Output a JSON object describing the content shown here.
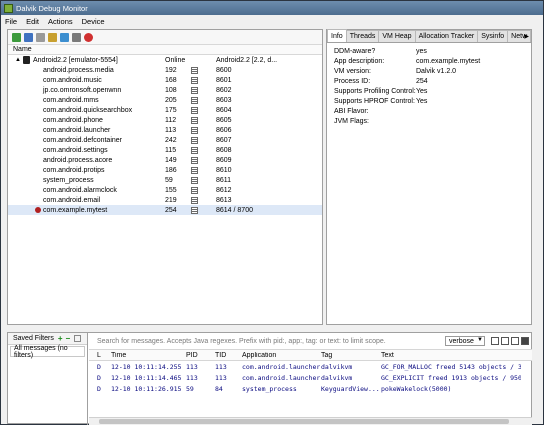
{
  "window": {
    "title": "Dalvik Debug Monitor"
  },
  "menu": [
    "File",
    "Edit",
    "Actions",
    "Device"
  ],
  "devices": {
    "columns": {
      "name": "Name"
    },
    "device": {
      "name": "Android2.2 [emulator-5554]",
      "status": "Online",
      "target": "Android2.2 [2.2, d..."
    },
    "processes": [
      {
        "name": "android.process.media",
        "pid": "192",
        "port": "8600"
      },
      {
        "name": "com.android.music",
        "pid": "168",
        "port": "8601"
      },
      {
        "name": "jp.co.omronsoft.openwnn",
        "pid": "108",
        "port": "8602"
      },
      {
        "name": "com.android.mms",
        "pid": "205",
        "port": "8603"
      },
      {
        "name": "com.android.quicksearchbox",
        "pid": "175",
        "port": "8604"
      },
      {
        "name": "com.android.phone",
        "pid": "112",
        "port": "8605"
      },
      {
        "name": "com.android.launcher",
        "pid": "113",
        "port": "8606"
      },
      {
        "name": "com.android.defcontainer",
        "pid": "242",
        "port": "8607"
      },
      {
        "name": "com.android.settings",
        "pid": "115",
        "port": "8608"
      },
      {
        "name": "android.process.acore",
        "pid": "149",
        "port": "8609"
      },
      {
        "name": "com.android.protips",
        "pid": "186",
        "port": "8610"
      },
      {
        "name": "system_process",
        "pid": "59",
        "port": "8611"
      },
      {
        "name": "com.android.alarmclock",
        "pid": "155",
        "port": "8612"
      },
      {
        "name": "com.android.email",
        "pid": "219",
        "port": "8613"
      },
      {
        "name": "com.example.mytest",
        "pid": "254",
        "port": "8614 / 8700"
      }
    ]
  },
  "tabs": [
    "Info",
    "Threads",
    "VM Heap",
    "Allocation Tracker",
    "Sysinfo",
    "Netw"
  ],
  "info": [
    {
      "k": "DDM-aware?",
      "v": "yes"
    },
    {
      "k": "App description:",
      "v": "com.example.mytest"
    },
    {
      "k": "VM version:",
      "v": "Dalvik v1.2.0"
    },
    {
      "k": "Process ID:",
      "v": "254"
    },
    {
      "k": "Supports Profiling Control:",
      "v": "Yes"
    },
    {
      "k": "Supports HPROF Control:",
      "v": "Yes"
    },
    {
      "k": "ABI Flavor:",
      "v": ""
    },
    {
      "k": "JVM Flags:",
      "v": ""
    }
  ],
  "filters": {
    "title": "Saved Filters",
    "items": [
      "All messages (no filters)"
    ]
  },
  "logcat": {
    "search_placeholder": "Search for messages. Accepts Java regexes. Prefix with pid:, app:, tag: or text: to limit scope.",
    "level": "verbose",
    "headers": [
      "L",
      "Time",
      "PID",
      "TID",
      "Application",
      "Tag",
      "Text"
    ],
    "rows": [
      [
        "D",
        "12-10 10:11:14.255",
        "113",
        "113",
        "com.android.launcher",
        "dalvikvm",
        "GC_FOR_MALLOC freed 5143 objects / 396504"
      ],
      [
        "D",
        "12-10 10:11:14.465",
        "113",
        "113",
        "com.android.launcher",
        "dalvikvm",
        "GC_EXPLICIT freed 1913 objects / 95040 by"
      ],
      [
        "D",
        "12-10 10:11:26.915",
        "59",
        "84",
        "system_process",
        "KeyguardView...",
        "pokeWakelock(5000)"
      ]
    ]
  },
  "colors": {
    "selection": "#dde8f7",
    "log_text": "#0a0a80",
    "title_bar": "#5a7a9c"
  }
}
